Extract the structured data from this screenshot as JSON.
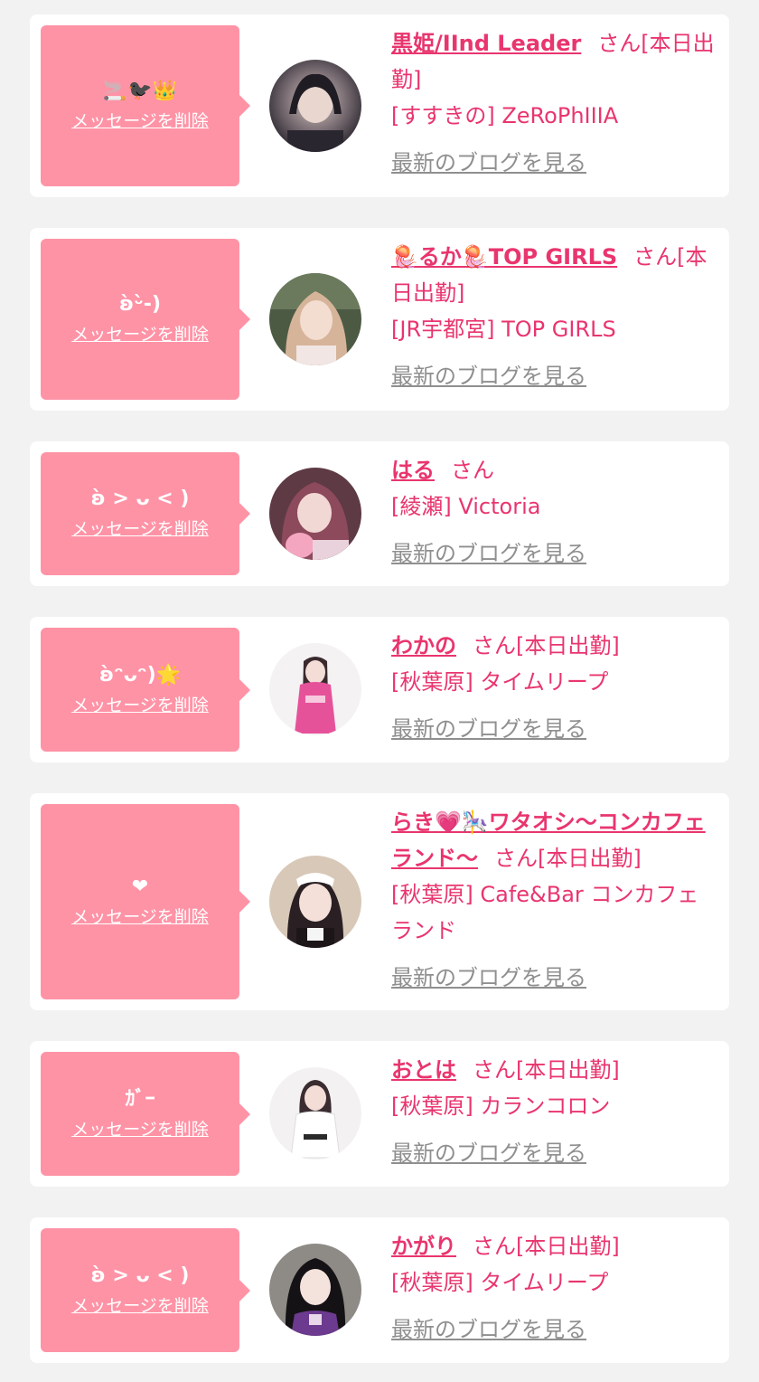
{
  "delete_label": "メッセージを削除",
  "blog_label": "最新のブログを見る",
  "colors": {
    "accent": "#e9356e",
    "bubble": "#ff93a6",
    "card_bg": "#ffffff",
    "page_bg": "#f2f2f2",
    "link_gray": "#8f8f8f"
  },
  "entries": [
    {
      "message": "🚬🐦‍⬛👑",
      "name": "黒姫/IInd Leader",
      "suffix": "さん[本日出勤]",
      "shop": "[すすきの] ZeRoPhIIIA"
    },
    {
      "message": "ʚ̀ᵕ̀-)",
      "name": "🪼るか🪼TOP GIRLS",
      "suffix": "さん[本日出勤]",
      "shop": "[JR宇都宮] TOP GIRLS"
    },
    {
      "message": "ʚ̀ > ᴗ < )",
      "name": "はる",
      "suffix": "さん",
      "shop": "[綾瀬] Victoria"
    },
    {
      "message": "ʚ̀ᵔᴗᵔ)🌟",
      "name": "わかの",
      "suffix": "さん[本日出勤]",
      "shop": "[秋葉原] タイムリープ"
    },
    {
      "message": "❤",
      "name": "らき💗🎠ワタオシ〜コンカフェランド〜",
      "suffix": "さん[本日出勤]",
      "shop": "[秋葉原] Cafe&Bar コンカフェランド"
    },
    {
      "message": "ｶﾞｰ",
      "name": "おとは",
      "suffix": "さん[本日出勤]",
      "shop": "[秋葉原] カランコロン"
    },
    {
      "message": "ʚ̀ > ᴗ < )",
      "name": "かがり",
      "suffix": "さん[本日出勤]",
      "shop": "[秋葉原] タイムリープ"
    }
  ]
}
